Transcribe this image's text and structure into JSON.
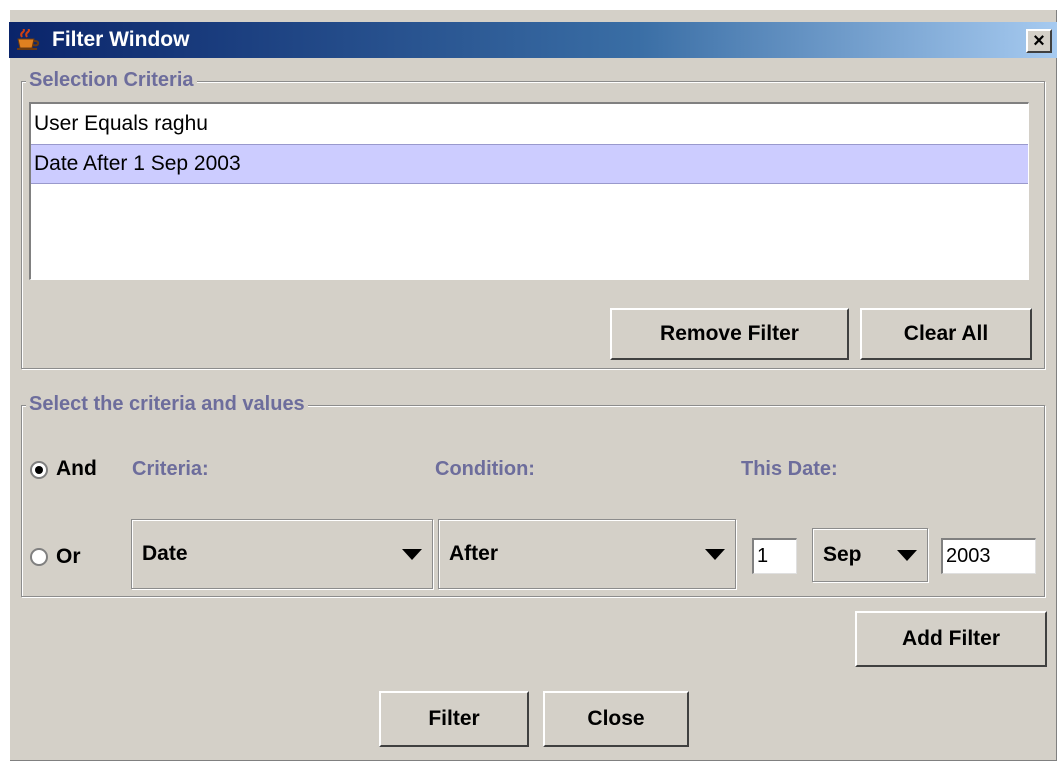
{
  "window": {
    "title": "Filter Window",
    "app_icon": "java-coffee-cup-icon",
    "close_glyph": "×"
  },
  "selection": {
    "legend": "Selection Criteria",
    "items": [
      {
        "label": "User Equals raghu",
        "selected": false
      },
      {
        "label": "Date After 1 Sep 2003",
        "selected": true
      }
    ],
    "remove_label": "Remove Filter",
    "clear_label": "Clear All"
  },
  "criteria": {
    "legend": "Select the criteria and values",
    "and_label": "And",
    "or_label": "Or",
    "logic_selected": "And",
    "criteria_label": "Criteria:",
    "condition_label": "Condition:",
    "date_label": "This Date:",
    "criteria_value": "Date",
    "condition_value": "After",
    "day_value": "1",
    "month_value": "Sep",
    "year_value": "2003"
  },
  "buttons": {
    "add_filter": "Add Filter",
    "filter": "Filter",
    "close": "Close"
  },
  "colors": {
    "title_gradient_start": "#0a246a",
    "title_gradient_end": "#a6caf0",
    "group_label": "#6d6d9c",
    "selected_row": "#ccccff",
    "window_bg": "#d4d0c8"
  }
}
